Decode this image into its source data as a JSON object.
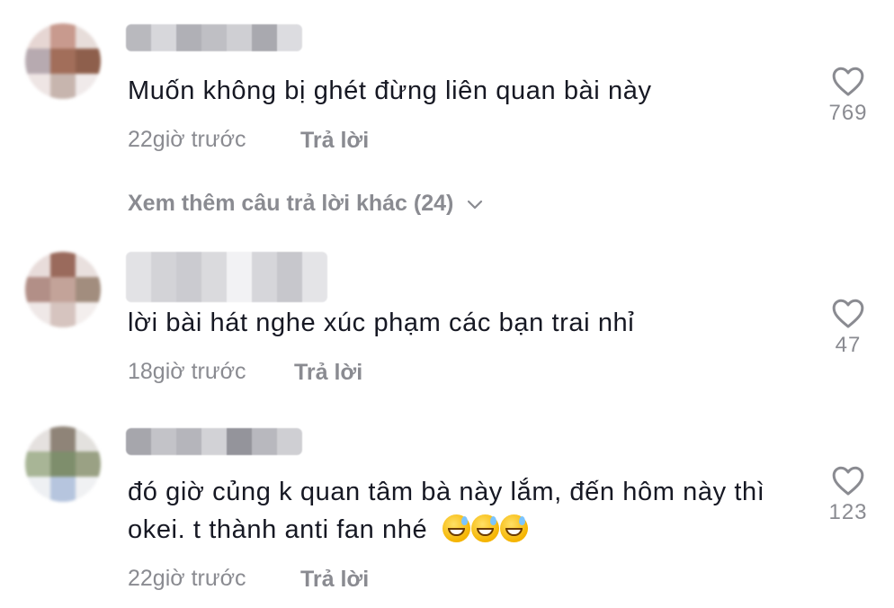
{
  "comments": [
    {
      "text_lines": [
        "Muốn không bị ghét đừng liên quan bài này"
      ],
      "time": "22giờ trước",
      "reply_label": "Trả lời",
      "likes": "769",
      "avatar_colors": [
        "#e6d6d3",
        "#c89a8e",
        "#e7ddda",
        "#b7aab0",
        "#a26e5a",
        "#8e5f4c",
        "#eee5e4",
        "#c7b5ae",
        "#f0eaea"
      ],
      "username_colors": [
        "#b9b9be",
        "#d7d7db",
        "#b0b0b6",
        "#bfbfc4",
        "#cfcfd3",
        "#a9a9af",
        "#dcdce0"
      ]
    },
    {
      "text_lines": [
        "lời bài hát nghe xúc phạm các bạn trai nhỉ"
      ],
      "time": "18giờ trước",
      "reply_label": "Trả lời",
      "likes": "47",
      "avatar_colors": [
        "#e8dcda",
        "#9a6a5c",
        "#e9e0de",
        "#b28f87",
        "#c3a399",
        "#a28d7e",
        "#efe8e7",
        "#d6c4bf",
        "#f3eeed"
      ],
      "username_colors": [
        "#e2e2e5",
        "#d3d3d7",
        "#cbcbd0",
        "#dadadd",
        "#f2f2f4",
        "#d6d6da",
        "#c7c7cc",
        "#e4e4e7"
      ]
    },
    {
      "text_lines": [
        "đó giờ củng k quan tâm bà này lắm, đến hôm này thì",
        "okei. t thành anti fan nhé"
      ],
      "emoji_count": 3,
      "emoji_name": "grinning-sweat-emoji",
      "time": "22giờ trước",
      "reply_label": "Trả lời",
      "likes": "123",
      "avatar_colors": [
        "#e5e1df",
        "#8f8478",
        "#e3e1de",
        "#a8b596",
        "#7e8e6c",
        "#9aa184",
        "#eef0f3",
        "#b6c5de",
        "#f0f1f3"
      ],
      "username_colors": [
        "#a6a6ac",
        "#c3c3c8",
        "#b5b5bb",
        "#d2d2d6",
        "#94949b",
        "#b8b8be",
        "#cfcfd3"
      ]
    }
  ],
  "view_more": {
    "label": "Xem thêm câu trả lời khác (24)",
    "icon": "chevron-down-icon"
  },
  "colors": {
    "text": "#161823",
    "muted": "#8a8b91"
  }
}
